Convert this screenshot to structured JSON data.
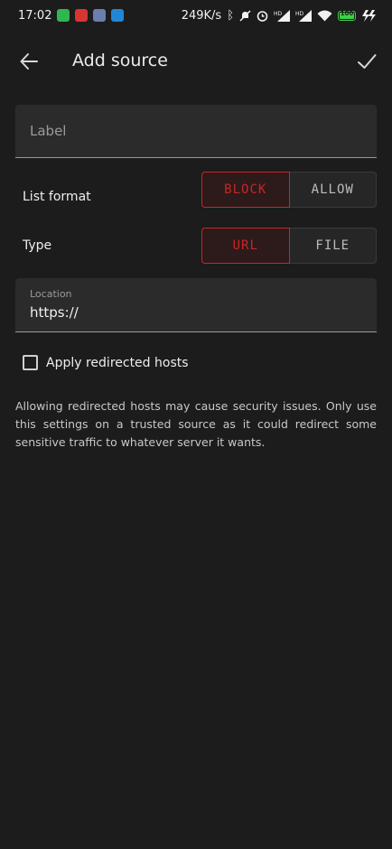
{
  "status_bar": {
    "time": "17:02",
    "network_speed": "249K/s",
    "battery_level": "100",
    "app_icons": [
      "wechat-icon",
      "red-app-icon",
      "blue-app-icon",
      "alipay-icon"
    ],
    "right_icons": [
      "bluetooth-icon",
      "mute-icon",
      "alarm-icon",
      "signal-hd-icon",
      "signal-hd-icon",
      "wifi-icon",
      "battery-icon",
      "charging-icon"
    ],
    "signal_badge": "HD"
  },
  "app_bar": {
    "title": "Add source",
    "back_icon": "arrow-left-icon",
    "confirm_icon": "check-icon"
  },
  "form": {
    "label_field": {
      "placeholder": "Label",
      "value": ""
    },
    "list_format": {
      "label": "List format",
      "options": [
        "BLOCK",
        "ALLOW"
      ],
      "selected": "BLOCK"
    },
    "type": {
      "label": "Type",
      "options": [
        "URL",
        "FILE"
      ],
      "selected": "URL"
    },
    "location_field": {
      "label": "Location",
      "value": "https://"
    },
    "apply_redirected": {
      "label": "Apply redirected hosts",
      "checked": false
    },
    "note": "Allowing redirected hosts may cause security issues. Only use this settings on a trusted source as it could redirect some sensitive traffic to whatever server it wants."
  },
  "colors": {
    "background": "#1c1c1c",
    "accent": "#c62828",
    "field_bg": "#2b2b2b"
  }
}
